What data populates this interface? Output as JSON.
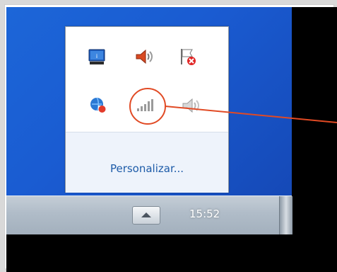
{
  "tray": {
    "icons": [
      {
        "name": "monitor-icon"
      },
      {
        "name": "speaker-icon"
      },
      {
        "name": "flag-error-icon"
      },
      {
        "name": "network-error-icon"
      },
      {
        "name": "signal-bars-icon"
      },
      {
        "name": "speaker-muted-icon"
      }
    ],
    "customize_link": "Personalizar..."
  },
  "taskbar": {
    "clock": "15:52",
    "show_hidden_icons": "up-arrow-icon"
  },
  "colors": {
    "desktop": "#1a5bd1",
    "callout": "#e14a24",
    "link": "#1d5ba8"
  }
}
